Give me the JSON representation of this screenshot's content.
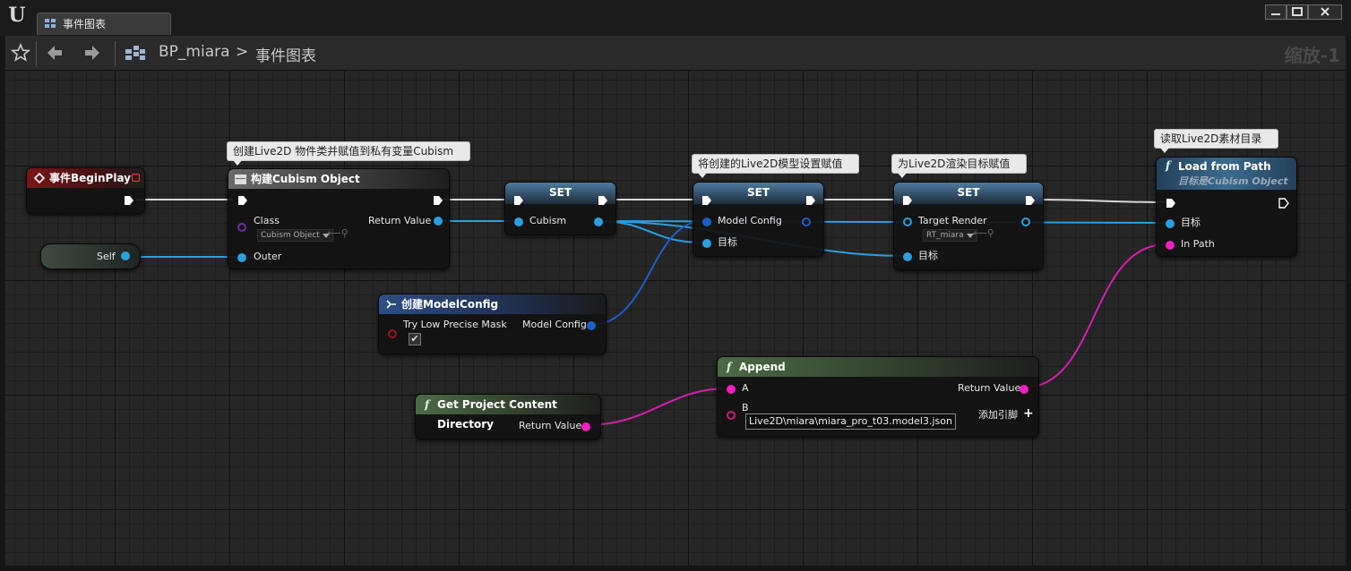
{
  "window": {
    "tab_title": "事件图表",
    "controls": [
      "minimize",
      "maximize",
      "close"
    ]
  },
  "toolbar": {
    "blueprint_name": "BP_miara",
    "separator": ">",
    "graph_name": "事件图表",
    "zoom_label": "缩放-1"
  },
  "comments": {
    "construct": "创建Live2D 物件类并赋值到私有变量Cubism",
    "set_model": "将创建的Live2D模型设置赋值",
    "set_target": "为Live2D渲染目标赋值",
    "load": "读取Live2D素材目录"
  },
  "nodes": {
    "begin_play": {
      "title": "事件BeginPlay"
    },
    "self": {
      "label": "Self"
    },
    "construct": {
      "title": "构建Cubism Object",
      "class_label": "Class",
      "class_value": "Cubism Object",
      "return_label": "Return Value",
      "outer_label": "Outer"
    },
    "set_cubism": {
      "title": "SET",
      "pin_label": "Cubism"
    },
    "set_model_config": {
      "title": "SET",
      "value_label": "Model Config",
      "target_label": "目标"
    },
    "set_target_render": {
      "title": "SET",
      "value_label": "Target Render",
      "value_default": "RT_miara",
      "target_label": "目标"
    },
    "load_from_path": {
      "title": "Load from Path",
      "subtitle": "目标是Cubism Object",
      "target_label": "目标",
      "path_label": "In Path"
    },
    "make_model_config": {
      "title": "创建ModelConfig",
      "mask_label": "Try Low Precise Mask",
      "mask_checked": true,
      "check_glyph": "✔",
      "output_label": "Model Config"
    },
    "get_project_dir": {
      "title": "Get Project Content Directory",
      "return_label": "Return Value"
    },
    "append": {
      "title": "Append",
      "a_label": "A",
      "b_label": "B",
      "b_value": "Live2D\\miara\\miara_pro_t03.model3.json",
      "return_label": "Return Value",
      "add_pin_label": "添加引脚"
    }
  },
  "colors": {
    "exec": "#ffffff",
    "object_pin": "#2a9fe0",
    "struct_pin": "#1c5fc6",
    "string_pin": "#f01ec0",
    "event_header": "#7a1518"
  },
  "icons": {
    "logo": "unreal-logo",
    "tab": "event-graph-icon",
    "favorite": "star-icon",
    "back": "arrow-left-icon",
    "forward": "arrow-right-icon",
    "breadcrumb": "blueprint-graph-icon",
    "function": "function-icon",
    "event": "event-icon"
  }
}
